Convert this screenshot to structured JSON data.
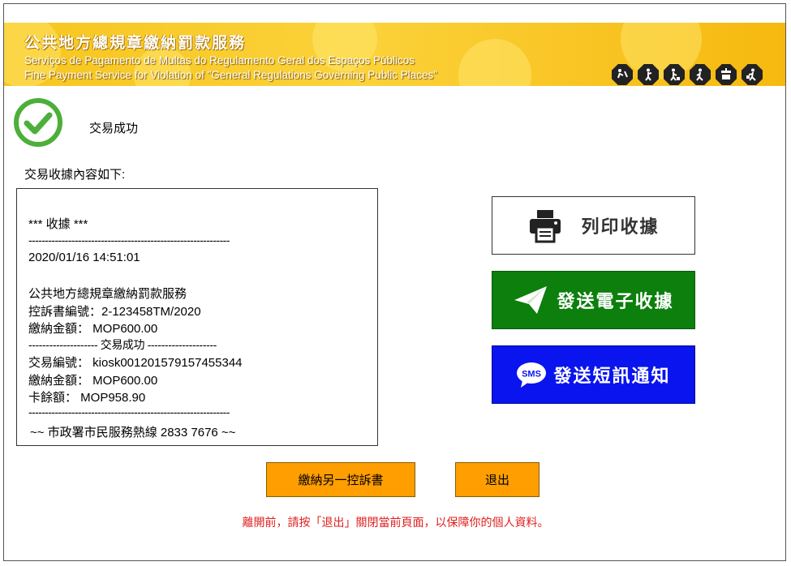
{
  "header": {
    "title_zh": "公共地方總規章繳納罰款服務",
    "title_pt": "Serviços de Pagamento de Multas do Regulamento Geral dos Espaços Públicos",
    "title_en": "Fine Payment Service for Violation of \"General Regulations Governing Public Places\"",
    "icons": [
      "graffiti-icon",
      "smoking-icon",
      "littering-icon",
      "spitting-icon",
      "pet-icon",
      "dumping-icon"
    ]
  },
  "status": {
    "icon": "success-check-icon",
    "text": "交易成功",
    "color": "#4caf3a"
  },
  "receipt": {
    "intro": "交易收據內容如下:",
    "lines": [
      "*** 收據 ***",
      "-------------------------------------------------------------",
      "2020/01/16 14:51:01",
      "公共地方總規章繳納罰款服務",
      "控訴書編號：2-123458TM/2020",
      "繳納金額： MOP600.00",
      "-------------------- 交易成功 --------------------",
      "交易編號： kiosk001201579157455344",
      "繳納金額： MOP600.00",
      "卡餘額： MOP958.90",
      "-------------------------------------------------------------",
      "~~ 市政署市民服務熱線 2833 7676 ~~"
    ]
  },
  "actions": {
    "print_label": "列印收據",
    "email_label": "發送電子收據",
    "sms_label": "發送短訊通知",
    "sms_icon_text": "SMS",
    "another_label": "繳納另一控訴書",
    "exit_label": "退出"
  },
  "notice": "離開前，請按「退出」關閉當前頁面，以保障你的個人資料。",
  "colors": {
    "banner": "#f7c51e",
    "email_button": "#0c7f0c",
    "sms_button": "#0a14ee",
    "action_button": "#ff9e00",
    "notice_text": "#e02020"
  }
}
